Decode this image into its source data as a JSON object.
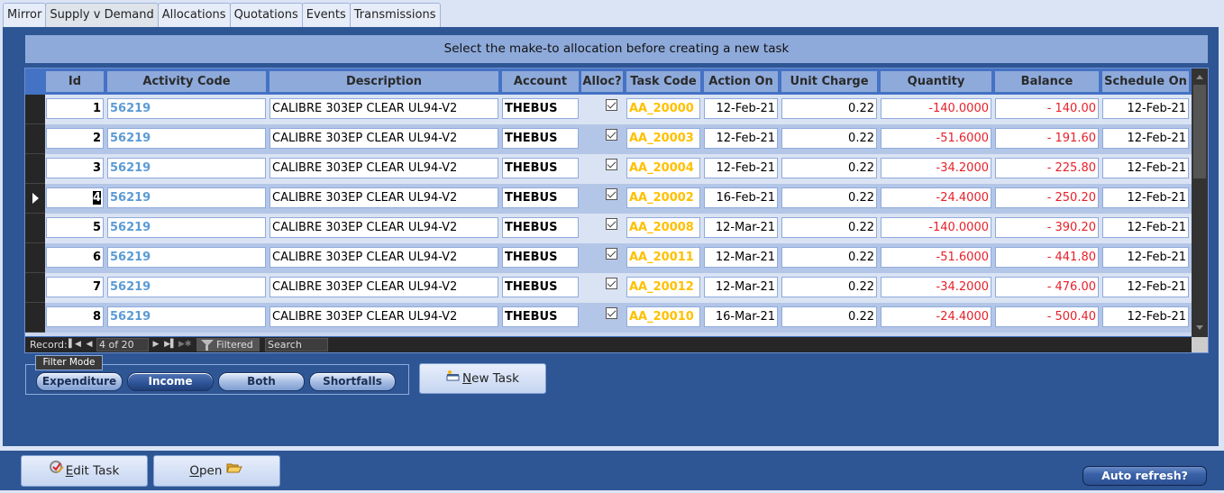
{
  "tabs": [
    {
      "label": "Mirror",
      "active": false
    },
    {
      "label": "Supply v Demand",
      "active": true
    },
    {
      "label": "Allocations",
      "active": false
    },
    {
      "label": "Quotations",
      "active": false
    },
    {
      "label": "Events",
      "active": false
    },
    {
      "label": "Transmissions",
      "active": false
    }
  ],
  "banner": "Select the make-to allocation before creating a new task",
  "grid": {
    "columns": [
      "Id",
      "Activity Code",
      "Description",
      "Account",
      "Alloc?",
      "Task Code",
      "Action On",
      "Unit Charge",
      "Quantity",
      "Balance",
      "Schedule On"
    ],
    "rows": [
      {
        "id": "1",
        "activity_code": "56219",
        "description": "CALIBRE 303EP CLEAR UL94-V2",
        "account": "THEBUS",
        "alloc": true,
        "task_code": "AA_20000",
        "action_on": "12-Feb-21",
        "unit_charge": "0.22",
        "quantity": "-140.0000",
        "balance": "- 140.00",
        "schedule_on": "12-Feb-21"
      },
      {
        "id": "2",
        "activity_code": "56219",
        "description": "CALIBRE 303EP CLEAR UL94-V2",
        "account": "THEBUS",
        "alloc": true,
        "task_code": "AA_20003",
        "action_on": "12-Feb-21",
        "unit_charge": "0.22",
        "quantity": "-51.6000",
        "balance": "- 191.60",
        "schedule_on": "12-Feb-21"
      },
      {
        "id": "3",
        "activity_code": "56219",
        "description": "CALIBRE 303EP CLEAR UL94-V2",
        "account": "THEBUS",
        "alloc": true,
        "task_code": "AA_20004",
        "action_on": "12-Feb-21",
        "unit_charge": "0.22",
        "quantity": "-34.2000",
        "balance": "- 225.80",
        "schedule_on": "12-Feb-21"
      },
      {
        "id": "4",
        "activity_code": "56219",
        "description": "CALIBRE 303EP CLEAR UL94-V2",
        "account": "THEBUS",
        "alloc": true,
        "task_code": "AA_20002",
        "action_on": "16-Feb-21",
        "unit_charge": "0.22",
        "quantity": "-24.4000",
        "balance": "- 250.20",
        "schedule_on": "12-Feb-21",
        "current": true
      },
      {
        "id": "5",
        "activity_code": "56219",
        "description": "CALIBRE 303EP CLEAR UL94-V2",
        "account": "THEBUS",
        "alloc": true,
        "task_code": "AA_20008",
        "action_on": "12-Mar-21",
        "unit_charge": "0.22",
        "quantity": "-140.0000",
        "balance": "- 390.20",
        "schedule_on": "12-Feb-21"
      },
      {
        "id": "6",
        "activity_code": "56219",
        "description": "CALIBRE 303EP CLEAR UL94-V2",
        "account": "THEBUS",
        "alloc": true,
        "task_code": "AA_20011",
        "action_on": "12-Mar-21",
        "unit_charge": "0.22",
        "quantity": "-51.6000",
        "balance": "- 441.80",
        "schedule_on": "12-Feb-21"
      },
      {
        "id": "7",
        "activity_code": "56219",
        "description": "CALIBRE 303EP CLEAR UL94-V2",
        "account": "THEBUS",
        "alloc": true,
        "task_code": "AA_20012",
        "action_on": "12-Mar-21",
        "unit_charge": "0.22",
        "quantity": "-34.2000",
        "balance": "- 476.00",
        "schedule_on": "12-Feb-21"
      },
      {
        "id": "8",
        "activity_code": "56219",
        "description": "CALIBRE 303EP CLEAR UL94-V2",
        "account": "THEBUS",
        "alloc": true,
        "task_code": "AA_20010",
        "action_on": "16-Mar-21",
        "unit_charge": "0.22",
        "quantity": "-24.4000",
        "balance": "- 500.40",
        "schedule_on": "12-Feb-21"
      }
    ]
  },
  "navbar": {
    "record_label": "Record:",
    "record_value": "4 of 20",
    "filter_label": "Filtered",
    "search_placeholder": "Search",
    "icons": {
      "first": "first-record-icon",
      "prev": "prev-record-icon",
      "next": "next-record-icon",
      "last": "last-record-icon",
      "new": "new-record-icon",
      "filter": "funnel-icon"
    }
  },
  "filter_mode": {
    "label": "Filter Mode",
    "options": [
      {
        "label": "Expenditure",
        "active": false
      },
      {
        "label": "Income",
        "active": true
      },
      {
        "label": "Both",
        "active": false
      },
      {
        "label": "Shortfalls",
        "active": false
      }
    ]
  },
  "buttons": {
    "new_task_label_rest": "ew Task",
    "new_task_accel": "N",
    "edit_task_accel": "E",
    "edit_task_label_rest": "dit Task",
    "open_accel": "O",
    "open_label_rest": "pen",
    "auto_refresh": "Auto refresh?"
  },
  "colors": {
    "panel": "#2e5694",
    "header_cell": "#8eaadb",
    "activity_code": "#5b9bd5",
    "task_code": "#ffc000",
    "negative": "#e8202a"
  }
}
